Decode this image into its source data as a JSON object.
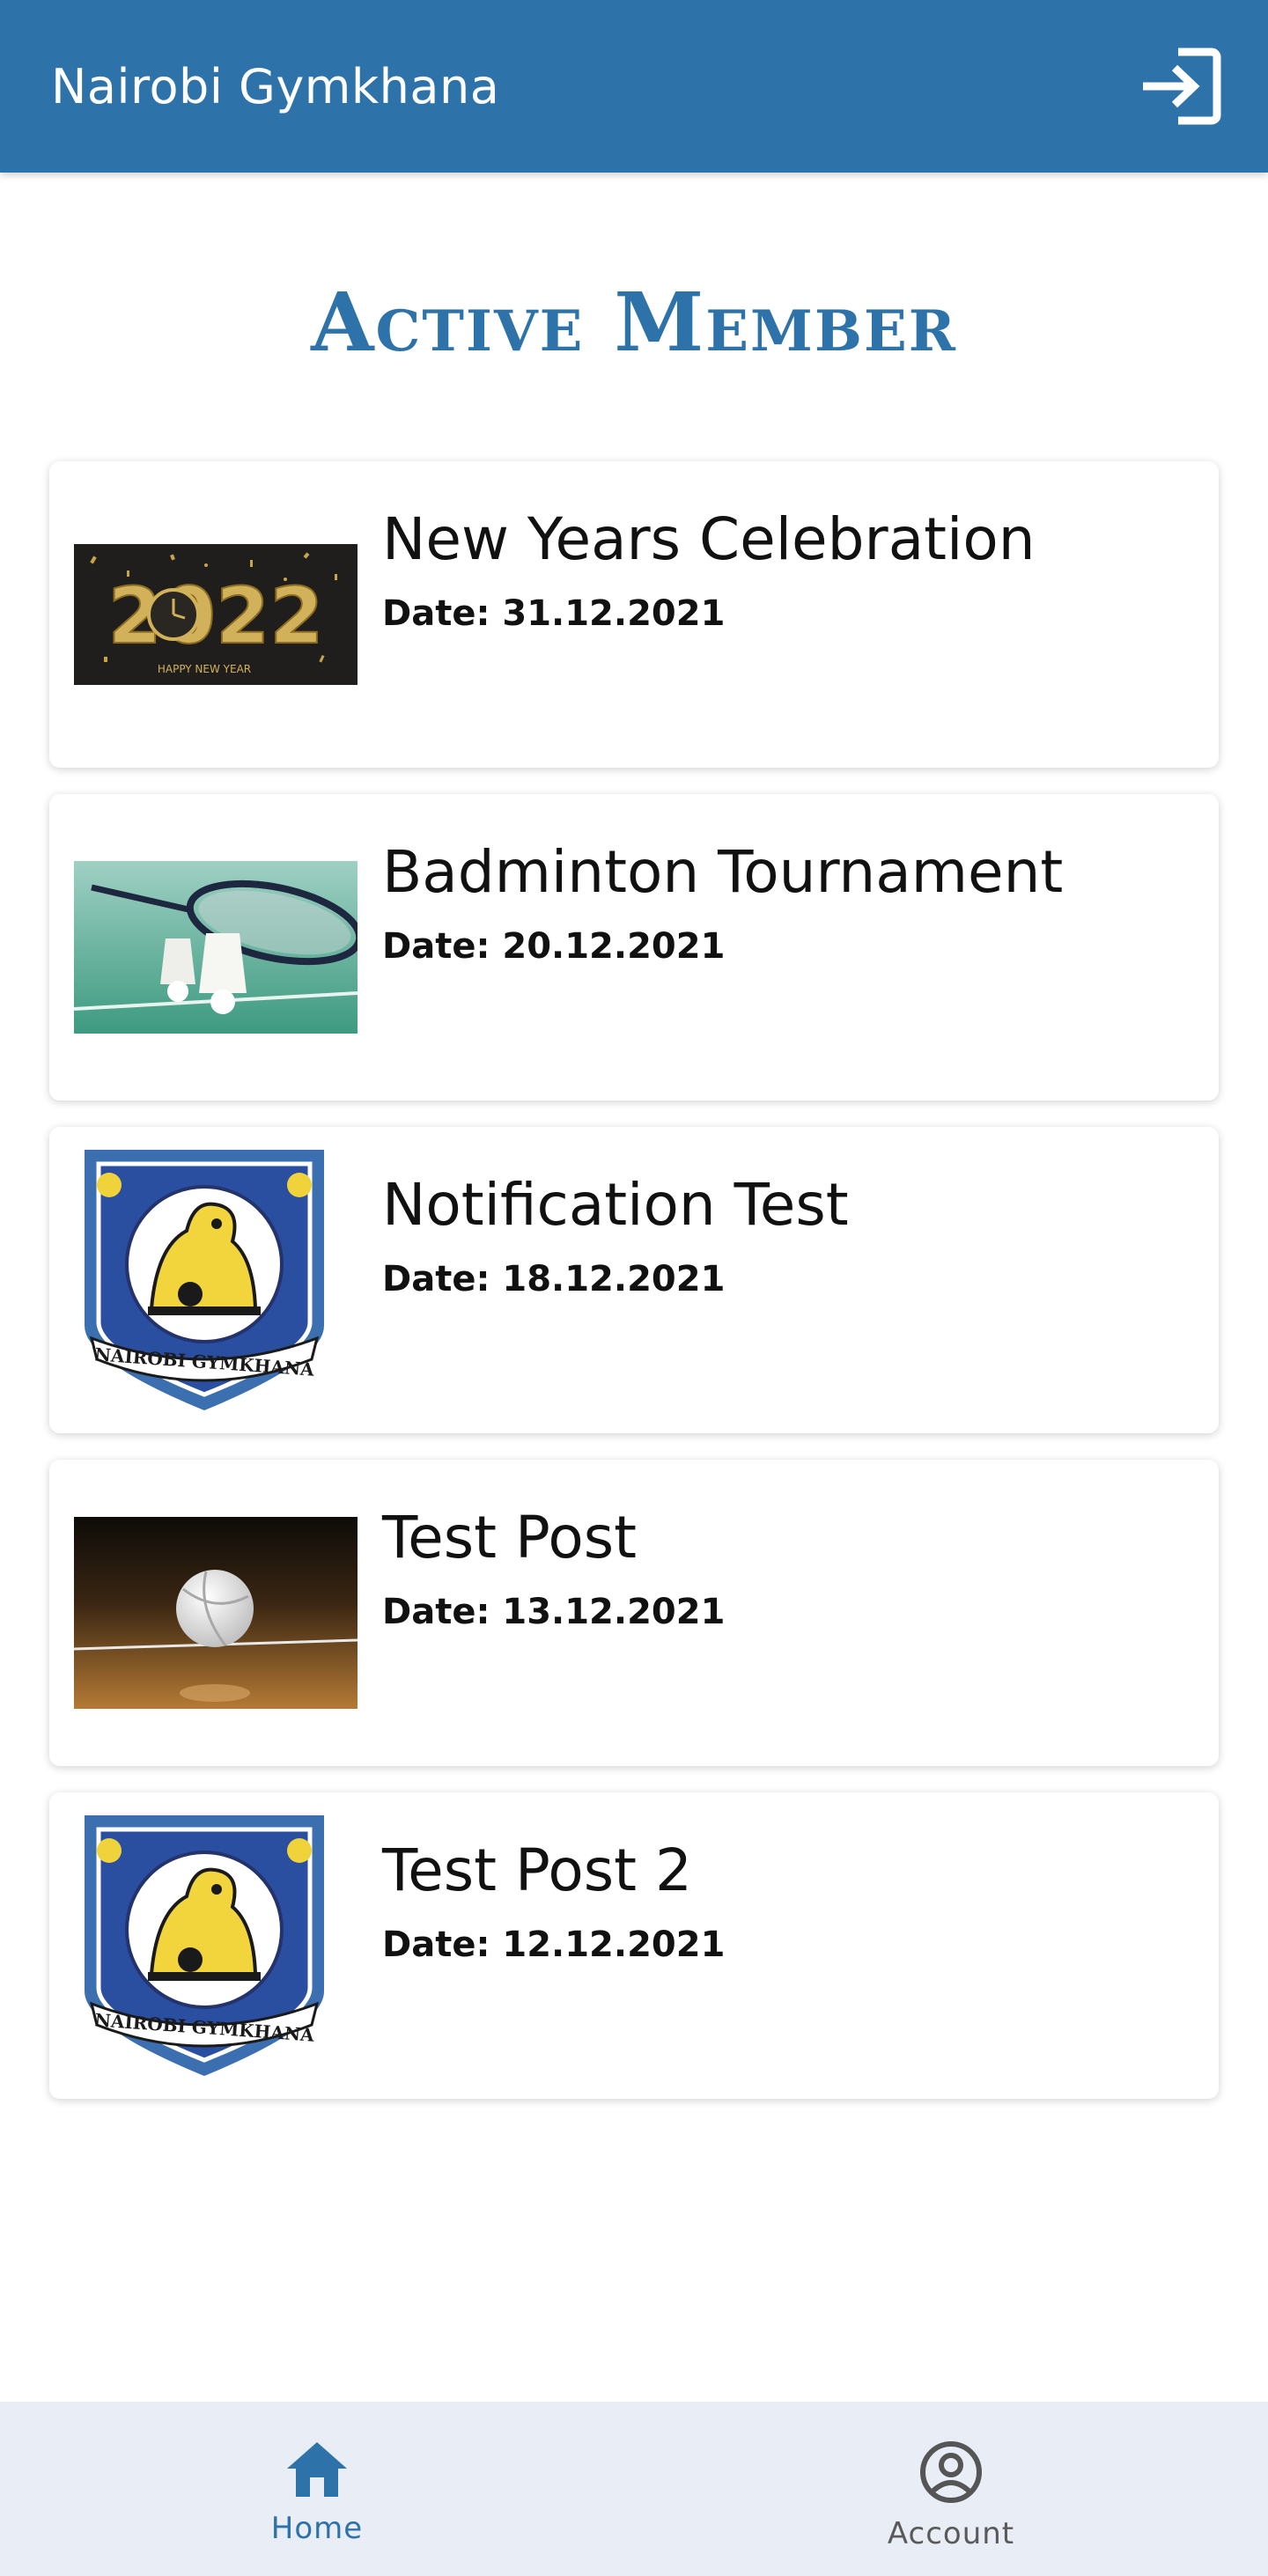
{
  "app_bar": {
    "title": "Nairobi Gymkhana",
    "action_icon": "login-icon"
  },
  "page": {
    "title": "Active Member"
  },
  "posts": [
    {
      "title": "New Years Celebration",
      "date": "Date: 31.12.2021",
      "thumbnail": "new-year-2022"
    },
    {
      "title": "Badminton Tournament",
      "date": "Date: 20.12.2021",
      "thumbnail": "badminton"
    },
    {
      "title": "Notification Test",
      "date": "Date: 18.12.2021",
      "thumbnail": "club-crest"
    },
    {
      "title": "Test Post",
      "date": "Date: 13.12.2021",
      "thumbnail": "volleyball"
    },
    {
      "title": "Test Post 2",
      "date": "Date: 12.12.2021",
      "thumbnail": "club-crest"
    }
  ],
  "bottom_nav": {
    "items": [
      {
        "label": "Home",
        "icon": "home-icon",
        "active": true
      },
      {
        "label": "Account",
        "icon": "account-icon",
        "active": false
      }
    ]
  },
  "crest": {
    "text": "NAIROBI GYMKHANA"
  },
  "new_year": {
    "year": "2022",
    "caption": "HAPPY NEW YEAR"
  },
  "colors": {
    "primary": "#2e72aa",
    "nav_background": "#e9eef6"
  }
}
